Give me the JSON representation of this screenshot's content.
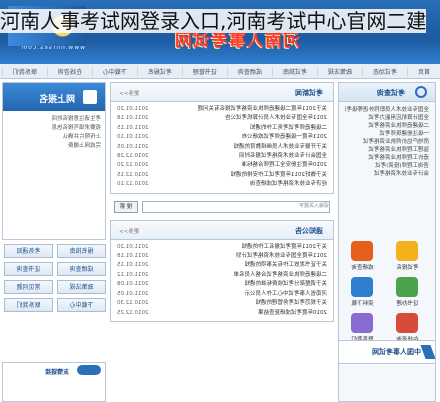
{
  "overlay_title": "河南人事考试网登录入口,河南考试中心官网二建",
  "banner": {
    "logo_text": "河南人事考试网",
    "url_text": "www.hnrsks.com"
  },
  "menu": [
    "首页",
    "考试动态",
    "政策法规",
    "考试指南",
    "成绩查询",
    "证书管理",
    "考试报名",
    "下载中心",
    "在线咨询",
    "联系我们"
  ],
  "left_col": {
    "search_title": "考试查询",
    "list": [
      "全国专业技术人员职称外语等级考试",
      "全国计算机应用能力考试",
      "二级建造师执业资格考试",
      "一级注册建筑师考试",
      "房地产估价师执业资格考试",
      "监理工程师执业资格考试",
      "造价工程师执业资格考试",
      "咨询工程师(投资)考试",
      "会计专业技术资格考试"
    ],
    "icons": [
      {
        "label": "考试报名",
        "icon": "pen-icon"
      },
      {
        "label": "成绩查询",
        "icon": "chart-icon"
      },
      {
        "label": "证书办理",
        "icon": "certificate-icon"
      },
      {
        "label": "资料下载",
        "icon": "download-icon"
      },
      {
        "label": "在线咨询",
        "icon": "chat-icon"
      },
      {
        "label": "联系我们",
        "icon": "phone-icon"
      }
    ],
    "ad_text": "中国人事考试网"
  },
  "mid": {
    "news_title": "考试新闻",
    "news_more": "更多>>",
    "news": [
      {
        "t": "关于2011年度二级建造师执业资格考试报名有关问题",
        "d": "2011.01.20"
      },
      {
        "t": "2011年全国专业技术人员计算机考试公告",
        "d": "2011.01.18"
      },
      {
        "t": "二级建造师考试考务工作的通知",
        "d": "2011.01.15"
      },
      {
        "t": "2011年度一级建造师考试成绩公布",
        "d": "2011.01.10"
      },
      {
        "t": "关于开展专业技术人员继续教育的通知",
        "d": "2011.01.05"
      },
      {
        "t": "全国会计专业技术资格考试报名时间",
        "d": "2010.12.28"
      },
      {
        "t": "2010年度注册安全工程师合格标准",
        "d": "2010.12.20"
      },
      {
        "t": "关于做好2011年度考试工作安排的通知",
        "d": "2010.12.15"
      },
      {
        "t": "经济专业技术资格考试成绩查询",
        "d": "2010.12.10"
      }
    ],
    "search_placeholder": "请输入关键字",
    "search_btn": "搜 索",
    "notice_title": "通知公告",
    "notice_more": "更多>>",
    "notices": [
      {
        "t": "关于2011年度考试报名工作的通知",
        "d": "2011.01.20"
      },
      {
        "t": "2011年度全国专业技术资格考试计划",
        "d": "2011.01.18"
      },
      {
        "t": "关于证书发放工作有关事项的通知",
        "d": "2011.01.15"
      },
      {
        "t": "二级建造师执业资格考试合格人员名单",
        "d": "2011.01.12"
      },
      {
        "t": "关于调整部分考试收费标准的通知",
        "d": "2011.01.08"
      },
      {
        "t": "河南省人事考试中心工作人员公示",
        "d": "2011.01.05"
      },
      {
        "t": "关于规范考试考务管理的通知",
        "d": "2010.12.30"
      },
      {
        "t": "2010年度考试成绩复查结果",
        "d": "2010.12.25"
      }
    ]
  },
  "right_col": {
    "notice_title": "网上报名",
    "notice_body": [
      "考生请注意报名时间",
      "按要求填写报名信息",
      "上传照片并确认",
      "完成网上缴费"
    ],
    "links": [
      [
        "报名指南",
        "考务通知"
      ],
      [
        "成绩查询",
        "证书查询"
      ],
      [
        "政策法规",
        "常见问题"
      ],
      [
        "下载中心",
        "联系我们"
      ]
    ],
    "foot_title": "友情链接"
  },
  "colors": {
    "brand": "#2a6fb8",
    "banner_red": "#ff3b30",
    "border": "#b9c8d9"
  }
}
